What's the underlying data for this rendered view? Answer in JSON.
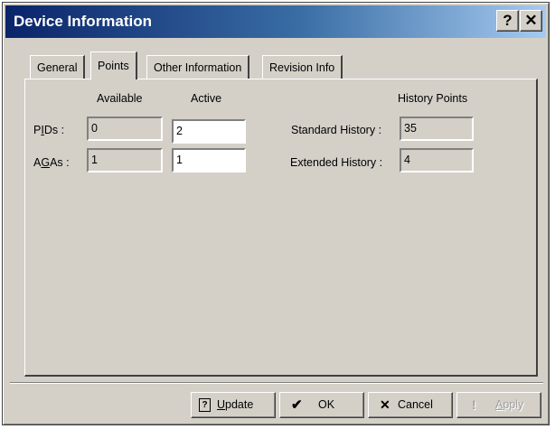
{
  "window": {
    "title": "Device Information"
  },
  "titlebar": {
    "help_glyph": "?",
    "close_glyph": "✕"
  },
  "tabs": [
    {
      "label": "General",
      "active": false
    },
    {
      "label": "Points",
      "active": true
    },
    {
      "label": "Other Information",
      "active": false
    },
    {
      "label": "Revision Info",
      "active": false
    }
  ],
  "points": {
    "available_header": "Available",
    "active_header": "Active",
    "history_header": "History Points",
    "pids": {
      "label_prefix": "P",
      "label_ul": "I",
      "label_suffix": "Ds :",
      "available": "0",
      "active": "2"
    },
    "agas": {
      "label_prefix": "A",
      "label_ul": "G",
      "label_suffix": "As :",
      "available": "1",
      "active": "1"
    },
    "standard_history": {
      "label": "Standard History :",
      "value": "35"
    },
    "extended_history": {
      "label": "Extended History :",
      "value": "4"
    }
  },
  "buttons": {
    "update": {
      "icon": "update-icon",
      "label_ul": "U",
      "label_rest": "pdate"
    },
    "ok": {
      "icon": "checkmark-icon",
      "glyph": "✔",
      "label": "OK"
    },
    "cancel": {
      "icon": "x-icon",
      "glyph": "✕",
      "label": "Cancel"
    },
    "apply": {
      "icon": "exclamation-icon",
      "glyph": "!",
      "label_ul": "A",
      "label_rest": "pply",
      "disabled": true
    }
  }
}
